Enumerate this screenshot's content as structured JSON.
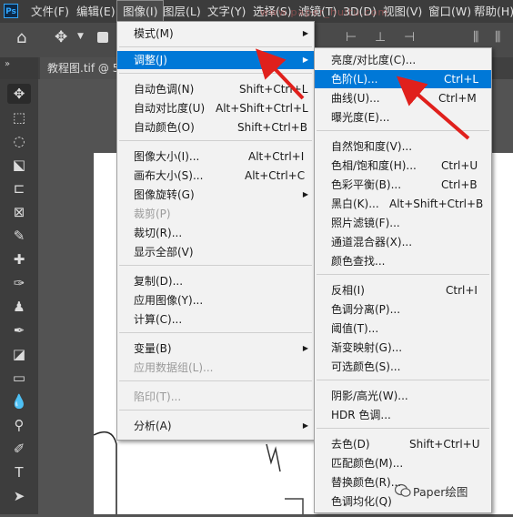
{
  "app": {
    "logo": "Ps"
  },
  "menubar": [
    "文件(F)",
    "编辑(E)",
    "图像(I)",
    "图层(L)",
    "文字(Y)",
    "选择(S)",
    "滤镜(T)",
    "3D(D)",
    "视图(V)",
    "窗口(W)",
    "帮助(H)"
  ],
  "document_tab": {
    "label": "教程图.tif @ 5"
  },
  "image_menu": [
    {
      "label": "模式(M)",
      "submenu": true
    },
    {
      "label": "调整(J)",
      "submenu": true,
      "highlighted": true
    },
    {
      "label": "自动色调(N)",
      "shortcut": "Shift+Ctrl+L"
    },
    {
      "label": "自动对比度(U)",
      "shortcut": "Alt+Shift+Ctrl+L"
    },
    {
      "label": "自动颜色(O)",
      "shortcut": "Shift+Ctrl+B"
    },
    {
      "label": "图像大小(I)...",
      "shortcut": "Alt+Ctrl+I"
    },
    {
      "label": "画布大小(S)...",
      "shortcut": "Alt+Ctrl+C"
    },
    {
      "label": "图像旋转(G)",
      "submenu": true
    },
    {
      "label": "裁剪(P)",
      "disabled": true
    },
    {
      "label": "裁切(R)..."
    },
    {
      "label": "显示全部(V)"
    },
    {
      "label": "复制(D)..."
    },
    {
      "label": "应用图像(Y)..."
    },
    {
      "label": "计算(C)..."
    },
    {
      "label": "变量(B)",
      "submenu": true
    },
    {
      "label": "应用数据组(L)...",
      "disabled": true
    },
    {
      "label": "陷印(T)...",
      "disabled": true
    },
    {
      "label": "分析(A)",
      "submenu": true
    }
  ],
  "adjust_menu": [
    {
      "label": "亮度/对比度(C)..."
    },
    {
      "label": "色阶(L)...",
      "shortcut": "Ctrl+L",
      "highlighted": true
    },
    {
      "label": "曲线(U)...",
      "shortcut": "Ctrl+M"
    },
    {
      "label": "曝光度(E)..."
    },
    {
      "label": "自然饱和度(V)..."
    },
    {
      "label": "色相/饱和度(H)...",
      "shortcut": "Ctrl+U"
    },
    {
      "label": "色彩平衡(B)...",
      "shortcut": "Ctrl+B"
    },
    {
      "label": "黑白(K)...",
      "shortcut": "Alt+Shift+Ctrl+B"
    },
    {
      "label": "照片滤镜(F)..."
    },
    {
      "label": "通道混合器(X)..."
    },
    {
      "label": "颜色查找..."
    },
    {
      "label": "反相(I)",
      "shortcut": "Ctrl+I"
    },
    {
      "label": "色调分离(P)..."
    },
    {
      "label": "阈值(T)..."
    },
    {
      "label": "渐变映射(G)..."
    },
    {
      "label": "可选颜色(S)..."
    },
    {
      "label": "阴影/高光(W)..."
    },
    {
      "label": "HDR 色调..."
    },
    {
      "label": "去色(D)",
      "shortcut": "Shift+Ctrl+U"
    },
    {
      "label": "匹配颜色(M)..."
    },
    {
      "label": "替换颜色(R)..."
    },
    {
      "label": "色调均化(Q)"
    }
  ],
  "watermark": {
    "brand": "Paper绘图"
  },
  "colors": {
    "highlight": "#0078d7",
    "annotation_arrow": "#e0201c",
    "menubar": "#3c3c3c"
  }
}
